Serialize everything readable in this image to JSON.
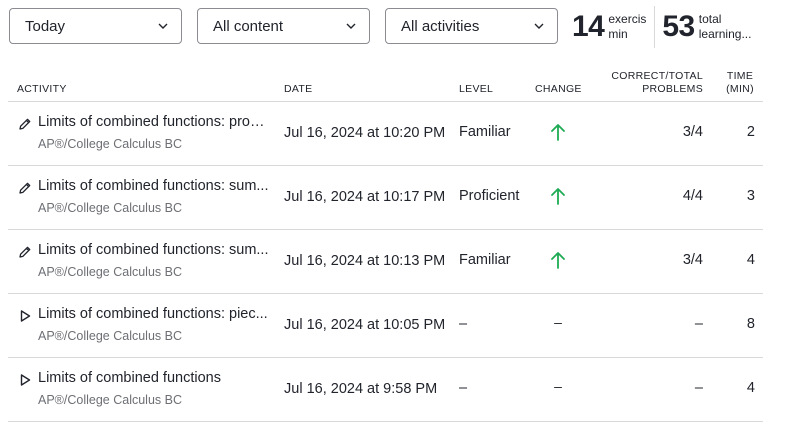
{
  "filters": {
    "period": "Today",
    "content": "All content",
    "activities": "All activities"
  },
  "stats": {
    "exercise_minutes": {
      "value": "14",
      "label_line1": "exercis",
      "label_line2": "min"
    },
    "total_learning": {
      "value": "53",
      "label_line1": "total",
      "label_line2": "learning..."
    }
  },
  "table": {
    "headers": {
      "activity": "ACTIVITY",
      "date": "DATE",
      "level": "LEVEL",
      "change": "CHANGE",
      "correct_line1": "CORRECT/TOTAL",
      "correct_line2": "PROBLEMS",
      "time_line1": "TIME",
      "time_line2": "(MIN)"
    },
    "rows": [
      {
        "icon": "pencil-icon",
        "title": "Limits of combined functions: prod...",
        "course": "AP®/College Calculus BC",
        "date": "Jul 16, 2024 at 10:20 PM",
        "level": "Familiar",
        "change": "up-arrow",
        "correct": "3/4",
        "time": "2"
      },
      {
        "icon": "pencil-icon",
        "title": "Limits of combined functions: sum...",
        "course": "AP®/College Calculus BC",
        "date": "Jul 16, 2024 at 10:17 PM",
        "level": "Proficient",
        "change": "up-arrow",
        "correct": "4/4",
        "time": "3"
      },
      {
        "icon": "pencil-icon",
        "title": "Limits of combined functions: sum...",
        "course": "AP®/College Calculus BC",
        "date": "Jul 16, 2024 at 10:13 PM",
        "level": "Familiar",
        "change": "up-arrow",
        "correct": "3/4",
        "time": "4"
      },
      {
        "icon": "play-icon",
        "title": "Limits of combined functions: piec...",
        "course": "AP®/College Calculus BC",
        "date": "Jul 16, 2024 at 10:05 PM",
        "level": "–",
        "change": "–",
        "correct": "–",
        "time": "8"
      },
      {
        "icon": "play-icon",
        "title": "Limits of combined functions",
        "course": "AP®/College Calculus BC",
        "date": "Jul 16, 2024 at 9:58 PM",
        "level": "–",
        "change": "–",
        "correct": "–",
        "time": "4"
      }
    ]
  },
  "colors": {
    "up_arrow": "#1fab54",
    "border": "#d6d8da",
    "text": "#21242c",
    "muted": "#6d6f74"
  }
}
